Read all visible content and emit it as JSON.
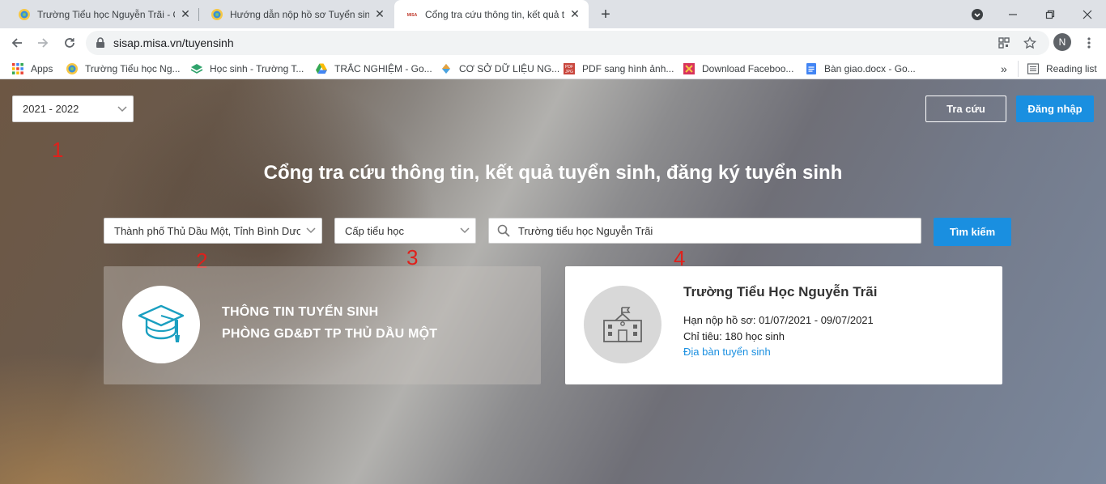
{
  "browser": {
    "tabs": [
      {
        "title": "Trường Tiểu học Nguyễn Trãi - Q",
        "icon": "site-favicon"
      },
      {
        "title": "Hướng dẫn nộp hồ sơ Tuyển sinh",
        "icon": "site-favicon"
      },
      {
        "title": "Cổng tra cứu thông tin, kết quả t",
        "icon": "misa-favicon"
      }
    ],
    "url": "sisap.misa.vn/tuyensinh",
    "profile_initial": "N",
    "bookmarks": [
      {
        "label": "Apps",
        "icon": "apps-grid-icon"
      },
      {
        "label": "Trường Tiểu học Ng...",
        "icon": "site-favicon"
      },
      {
        "label": "Học sinh - Trường T...",
        "icon": "layers-icon"
      },
      {
        "label": "TRẮC NGHIỆM - Go...",
        "icon": "google-drive-icon"
      },
      {
        "label": "CƠ SỞ DỮ LIỆU NG...",
        "icon": "diamond-icon"
      },
      {
        "label": "PDF sang hình ảnh...",
        "icon": "pdf-jpg-icon"
      },
      {
        "label": "Download Faceboo...",
        "icon": "download-icon"
      },
      {
        "label": "Bàn giao.docx - Go...",
        "icon": "docs-icon"
      }
    ],
    "overflow": "»",
    "reading_list": "Reading list"
  },
  "page": {
    "year_select": "2021 - 2022",
    "lookup_button": "Tra cứu",
    "login_button": "Đăng nhập",
    "heading": "Cổng tra cứu thông tin, kết quả tuyển sinh, đăng ký tuyển sinh",
    "location_select": "Thành phố Thủ Dầu Một, Tỉnh Bình Dương",
    "level_select": "Cấp tiểu học",
    "search_value": "Trường tiểu học Nguyễn Trãi",
    "search_button": "Tìm kiếm",
    "annotations": [
      "1",
      "2",
      "3",
      "4"
    ],
    "info_card": {
      "line1": "THÔNG TIN TUYỂN SINH",
      "line2": "PHÒNG GD&ĐT TP THỦ DẦU MỘT"
    },
    "school_card": {
      "name": "Trường Tiểu Học Nguyễn Trãi",
      "deadline": "Hạn nộp hồ sơ: 01/07/2021 - 09/07/2021",
      "quota": "Chỉ tiêu: 180 học sinh",
      "area_link": "Địa bàn tuyển sinh"
    }
  },
  "colors": {
    "accent": "#1a8fe0",
    "annotation": "#e0201b"
  }
}
